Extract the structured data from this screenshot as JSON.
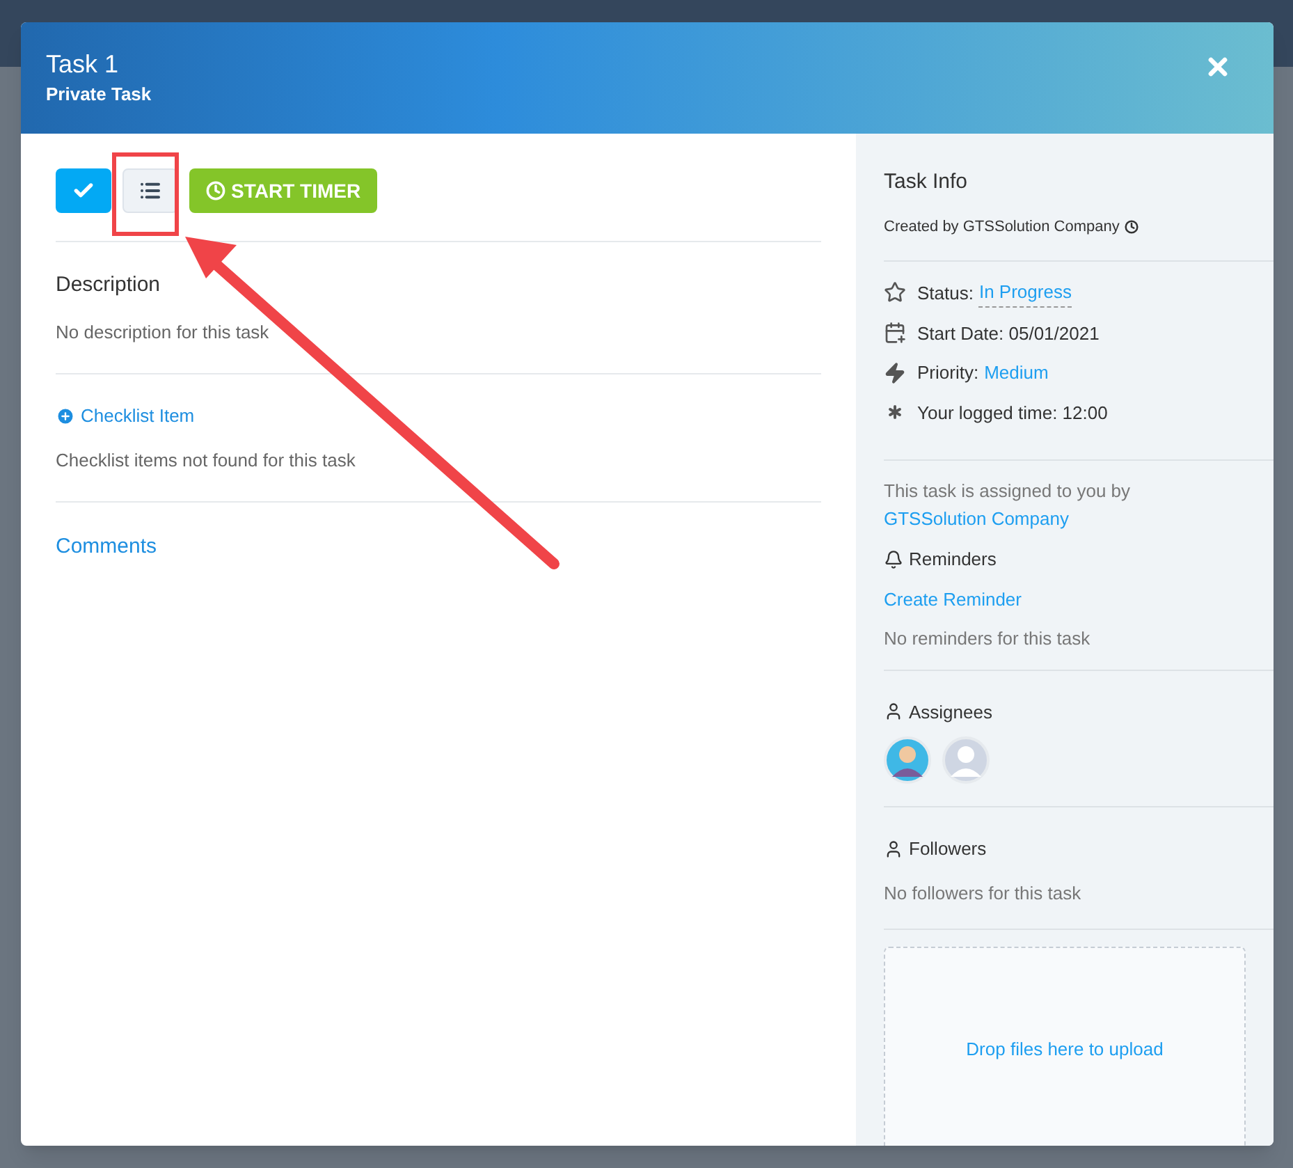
{
  "header": {
    "title": "Task 1",
    "subtitle": "Private Task"
  },
  "toolbar": {
    "buttons": [
      {
        "kind": "complete"
      },
      {
        "kind": "checklist"
      },
      {
        "kind": "timer",
        "label": "START TIMER"
      }
    ]
  },
  "description": {
    "heading": "Description",
    "text": "No description for this task"
  },
  "checklist": {
    "link": "Checklist Item",
    "empty": "Checklist items not found for this task"
  },
  "comments": {
    "heading": "Comments"
  },
  "task_info": {
    "heading": "Task Info",
    "created_by": "Created by GTSSolution Company",
    "fields": [
      {
        "kind": "status",
        "label": "Status:",
        "value": "In Progress"
      },
      {
        "kind": "date",
        "label": "Start Date: 05/01/2021"
      },
      {
        "kind": "priority",
        "label": "Priority:",
        "value": "Medium"
      },
      {
        "kind": "time",
        "label": "Your logged time: 12:00"
      }
    ]
  },
  "assignment": {
    "text": "This task is assigned to you by",
    "by": "GTSSolution Company"
  },
  "reminders": {
    "heading": "Reminders",
    "link": "Create Reminder",
    "empty": "No reminders for this task"
  },
  "assignees": {
    "heading": "Assignees",
    "avatars": [
      {
        "kind": "photo"
      },
      {
        "kind": "placeholder"
      }
    ]
  },
  "followers": {
    "heading": "Followers",
    "empty": "No followers for this task"
  },
  "upload": {
    "text": "Drop files here to upload"
  }
}
